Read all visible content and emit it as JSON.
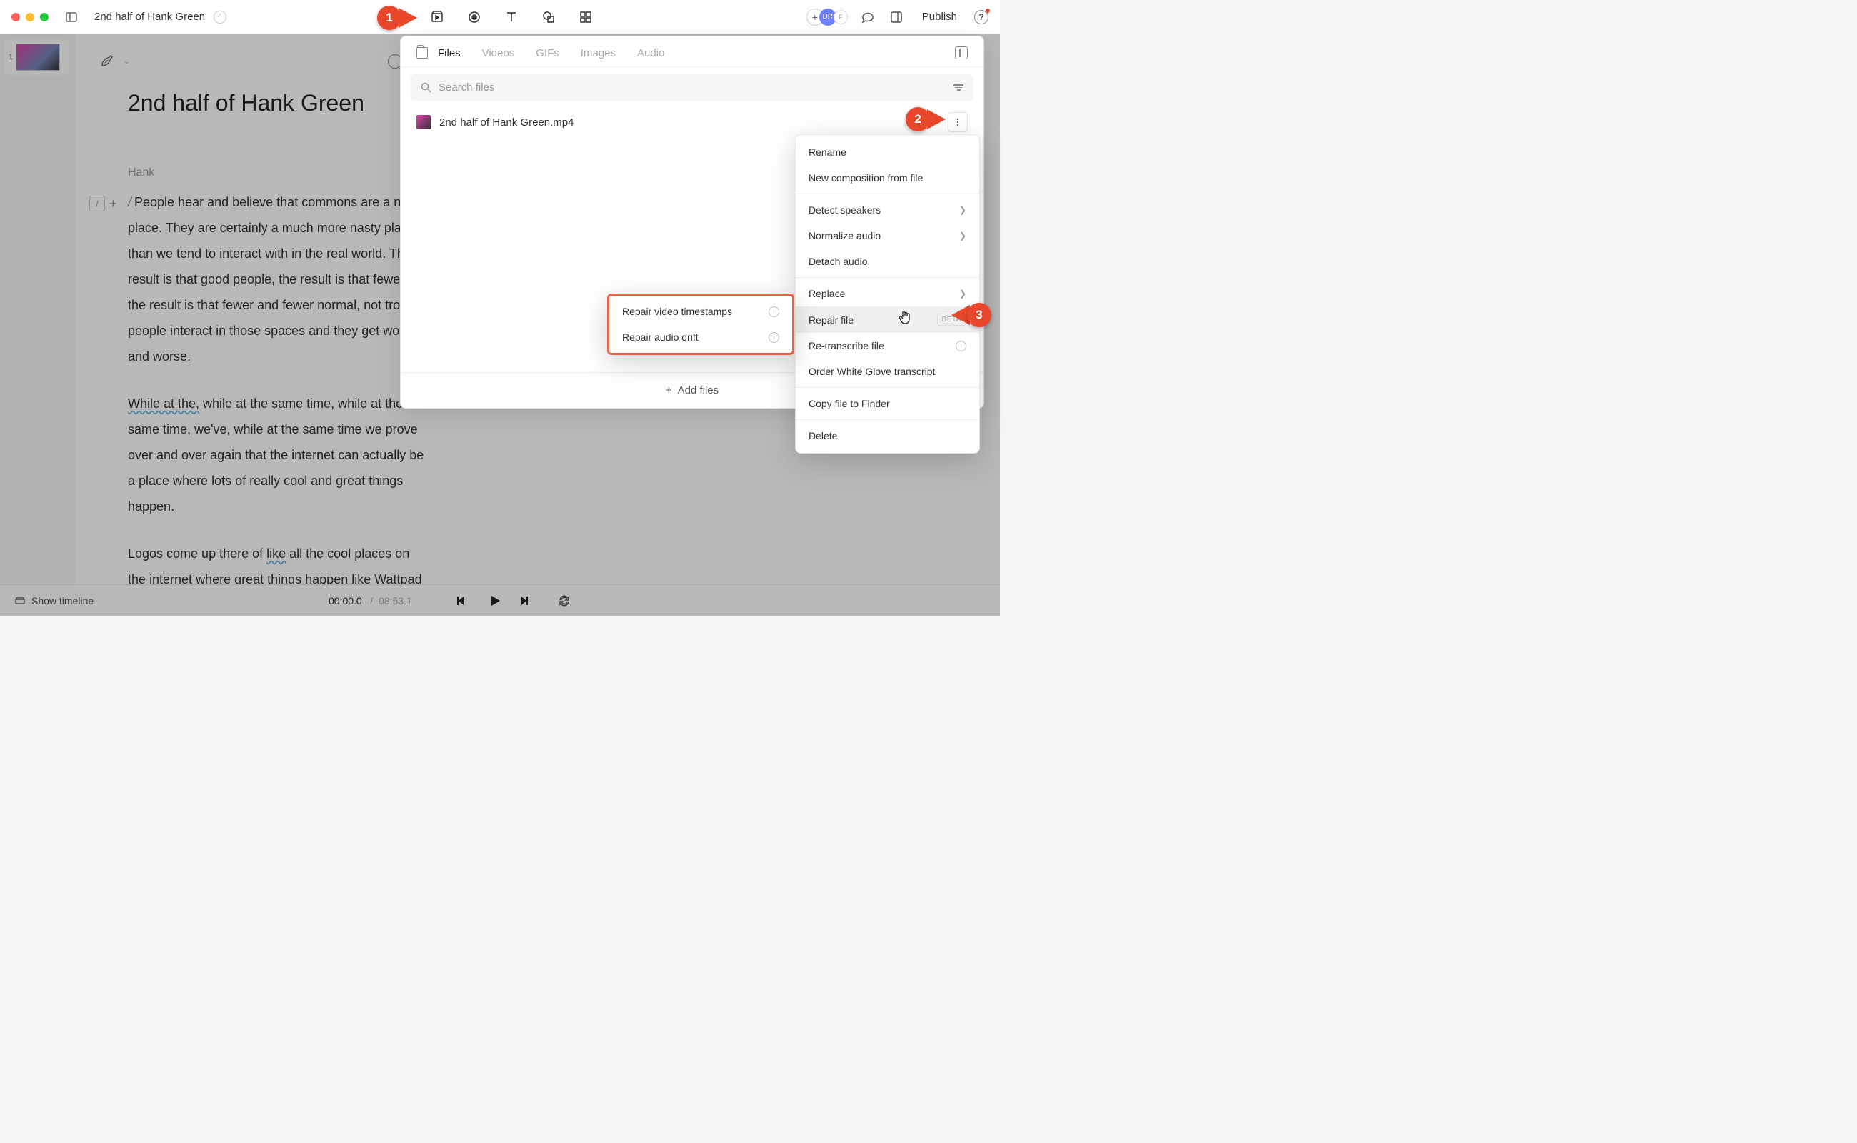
{
  "header": {
    "title": "2nd half of Hank Green",
    "publish": "Publish",
    "avatar1": "DR",
    "avatar2": "F"
  },
  "document": {
    "title": "2nd half of Hank Green",
    "speaker": "Hank",
    "para1_lead": "/",
    "para1": "People hear and believe that commons are a nasty place. They are certainly a much more nasty place than we tend to interact with in the real world. The result is that good people, the result is that fewer, the result is that fewer and fewer normal, not trolly people interact in those spaces and they get worse and worse.",
    "para2_wavy": "While at the,",
    "para2_rest": " while at the same time, while at the same time, we've, while at the same time we prove over and over again that the internet can actually be a place where lots of really cool and great things happen.",
    "para3_a": "Logos come up there of ",
    "para3_wavy": "like",
    "para3_b": " all the cool places on the internet where great things happen like Wattpad and Tumblr and Facebook and"
  },
  "playbar": {
    "show_timeline": "Show timeline",
    "cur": "00:00.0",
    "sep": "/",
    "dur": "08:53.1"
  },
  "files_panel": {
    "tabs": {
      "files": "Files",
      "videos": "Videos",
      "gifs": "GIFs",
      "images": "Images",
      "audio": "Audio"
    },
    "search_placeholder": "Search files",
    "file_name": "2nd half of Hank Green.mp4",
    "add_files": "Add files"
  },
  "ctx": {
    "rename": "Rename",
    "new_comp": "New composition from file",
    "detect": "Detect speakers",
    "normalize": "Normalize audio",
    "detach": "Detach audio",
    "replace": "Replace",
    "repair": "Repair file",
    "repair_badge": "BETA",
    "retranscribe": "Re-transcribe file",
    "whiteglove": "Order White Glove transcript",
    "copy": "Copy file to Finder",
    "delete": "Delete"
  },
  "submenu": {
    "repair_ts": "Repair video timestamps",
    "repair_drift": "Repair audio drift"
  },
  "callouts": {
    "c1": "1",
    "c2": "2",
    "c3": "3"
  }
}
